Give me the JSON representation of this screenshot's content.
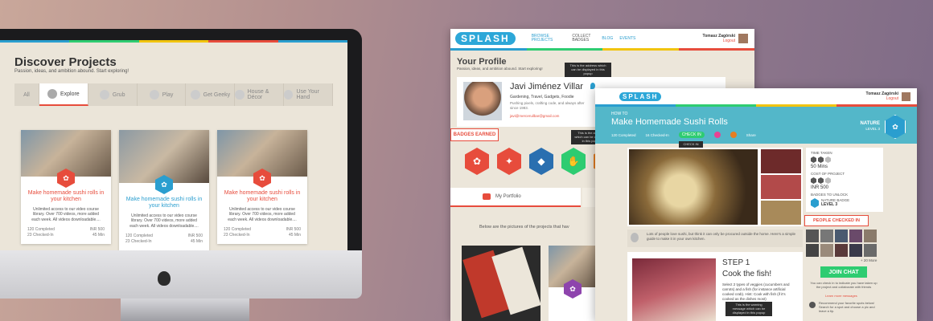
{
  "discover": {
    "title": "Discover Projects",
    "subtitle": "Passion, ideas, and ambition abound. Start exploring!",
    "tabs": [
      {
        "label": "All",
        "icon": "grid-icon"
      },
      {
        "label": "Explore",
        "icon": "compass-icon"
      },
      {
        "label": "Grub",
        "icon": "fork-icon"
      },
      {
        "label": "Play",
        "icon": "play-icon"
      },
      {
        "label": "Get Geeky",
        "icon": "chip-icon"
      },
      {
        "label": "House & Décor",
        "icon": "house-icon"
      },
      {
        "label": "Use Your Hand",
        "icon": "hand-icon"
      }
    ],
    "cards": [
      {
        "title": "Make homemade sushi rolls in your kitchen",
        "desc": "Unlimited access to our video course library. Over 700 videos, more added each week. All videos downloadable....",
        "completed": "120 Completed",
        "checked": "23 Checked-In",
        "price": "INR 500",
        "time": "45 Min"
      },
      {
        "title": "Make homemade sushi rolls in your kitchen",
        "desc": "Unlimited access to our video course library. Over 700 videos, more added each week. All videos downloadable....",
        "completed": "120 Completed",
        "checked": "23 Checked-In",
        "price": "INR 500",
        "time": "45 Min"
      },
      {
        "title": "Make homemade sushi rolls in your kitchen",
        "desc": "Unlimited access to our video course library. Over 700 videos, more added each week. All videos downloadable....",
        "completed": "120 Completed",
        "checked": "23 Checked-In",
        "price": "INR 500",
        "time": "45 Min"
      }
    ]
  },
  "nav": {
    "logo": "SPLASH",
    "browse": "BROWSE",
    "projects": "PROJECTS",
    "collect": "COLLECT",
    "badges": "BADGES",
    "blog": "BLOG",
    "events": "EVENTS",
    "user": "Tomasz Zagórski",
    "logout": "Logout"
  },
  "profile": {
    "title": "Your Profile",
    "subtitle": "Passion, ideas, and ambition abound. Start exploring!",
    "tooltip": "This is the address which can be displayed in this popup",
    "name": "Javi Jiménez Villar",
    "interests": "Gardening, Travel, Gadgets, Foodie",
    "bio": "Pushing pixels, crafting code, and always after since 1983.",
    "email": "javi@merceruilbar@gmail.com",
    "badges_earned": "BADGES EARNED",
    "badges_tooltip": "This is the address which can be displayed in this popup",
    "portfolio": "My Portfolio",
    "portfolio_note": "Below are the pictures of the projects that hav"
  },
  "project": {
    "howto": "HOW TO",
    "title": "Make Homemade Sushi Rolls",
    "completed": "120 Completed",
    "checked": "16 Checked-In",
    "checkin": "CHECK IN",
    "checkin_tip": "CHECK IN",
    "share": "Share",
    "category": "NATURE",
    "level": "LEVEL 3",
    "time_label": "TIME TAKEN",
    "time": "50 Mins",
    "cost_label": "COST OF PROJECT",
    "cost": "INR 500",
    "badge_unlock": "BADGES TO UNLOCK",
    "badge_name": "NATURE BADGE",
    "badge_level": "LEVEL 3",
    "people_checked": "PEOPLE CHECKED IN",
    "more": "+ 20 More",
    "join": "JOIN CHAT",
    "join_desc": "You can check in to indicate you have taken up the project and collaborate with friends",
    "learn_more": "Learn more messages",
    "recommend": "Recommend your favorite spots below! Search for a spot and choose a pic and leave a tip.",
    "note": "Lots of people love sushi, but think it can only be procured outside the home. Here's a simple guide to make it in your own kitchen.",
    "step": "STEP 1",
    "step_title": "Cook the fish!",
    "step_desc": "Select 2 types of veggies (cucumbers and carrots) and a fish (for instance artificial cooked crab). Hint: Cook with fish (if it's cooked as the dishes most)",
    "step_tip": "This is the warning message which can be displayed in this popup"
  },
  "colors": {
    "red": "#e74c3c",
    "blue": "#2a9ecf",
    "orange": "#e67e22",
    "green": "#2ecc71",
    "yellow": "#f1c40f",
    "teal": "#53b7c9"
  }
}
